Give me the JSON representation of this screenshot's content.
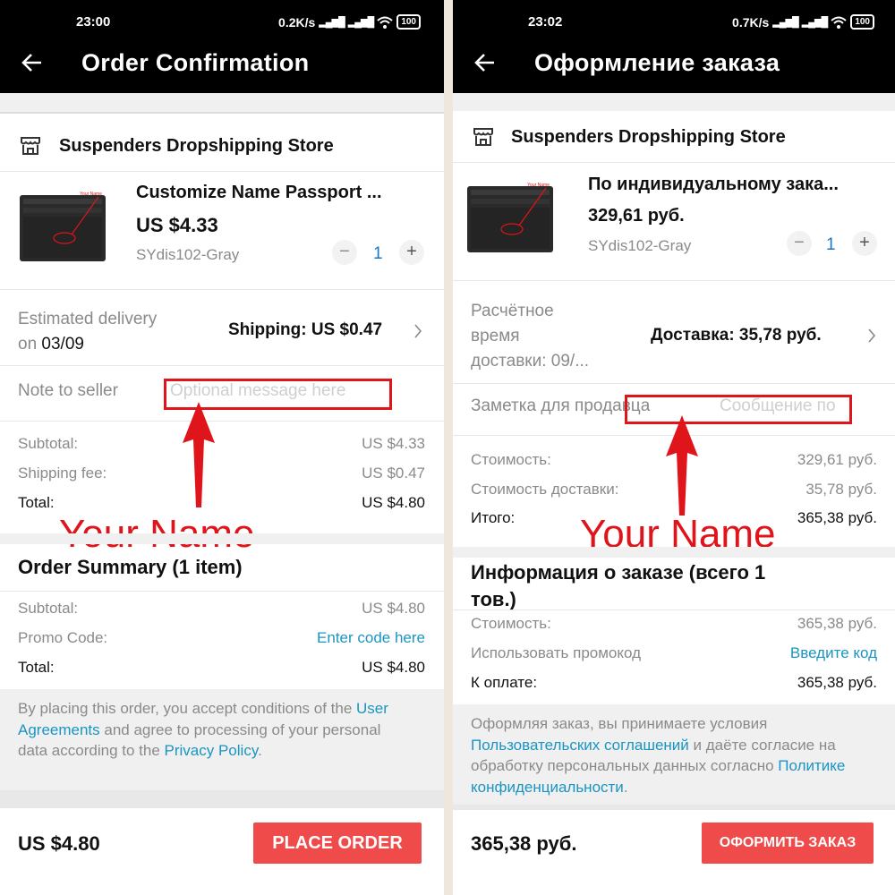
{
  "colors": {
    "accent_red": "#e0141b",
    "button_red": "#f04b4b",
    "link_blue": "#1a95c2",
    "qty_blue": "#1a78c2"
  },
  "left": {
    "status": {
      "time": "23:00",
      "speed": "0.2K/s",
      "battery": "100"
    },
    "header": {
      "title": "Order Confirmation"
    },
    "store_name": "Suspenders Dropshipping Store",
    "product": {
      "name": "Customize Name Passport ...",
      "price": "US $4.33",
      "sku": "SYdis102-Gray",
      "quantity": "1",
      "minus": "−",
      "plus": "+",
      "image_label": "Your Name"
    },
    "delivery": {
      "line1": "Estimated delivery",
      "line2_prefix": "on ",
      "date": "03/09",
      "shipping": "Shipping: US $0.47"
    },
    "note": {
      "label": "Note to seller",
      "placeholder": "Optional message here"
    },
    "costs": {
      "subtotal_label": "Subtotal:",
      "subtotal_value": "US $4.33",
      "shipping_label": "Shipping fee:",
      "shipping_value": "US $0.47",
      "total_label": "Total:",
      "total_value": "US $4.80"
    },
    "annotation": "Your Name",
    "summary": {
      "title": "Order Summary (1 item)",
      "subtotal_label": "Subtotal:",
      "subtotal_value": "US $4.80",
      "promo_label": "Promo Code:",
      "promo_value": "Enter code here",
      "total_label": "Total:",
      "total_value": "US $4.80"
    },
    "terms": {
      "p1": "By placing this order, you accept conditions of the ",
      "link1": "User Agreements",
      "p2": " and agree to processing of your personal data according to the ",
      "link2": "Privacy Policy",
      "p3": "."
    },
    "footer": {
      "total": "US $4.80",
      "button": "PLACE ORDER"
    }
  },
  "right": {
    "status": {
      "time": "23:02",
      "speed": "0.7K/s",
      "battery": "100"
    },
    "header": {
      "title": "Оформление заказа"
    },
    "store_name": "Suspenders Dropshipping Store",
    "product": {
      "name": "По индивидуальному зака...",
      "price": "329,61 руб.",
      "sku": "SYdis102-Gray",
      "quantity": "1",
      "minus": "−",
      "plus": "+",
      "image_label": "Your Name"
    },
    "delivery": {
      "line1": "Расчётное",
      "line2": "время",
      "line3": "доставки: 09/...",
      "shipping": "Доставка: 35,78 руб."
    },
    "note": {
      "label": "Заметка для продавца",
      "placeholder": "Сообщение по"
    },
    "costs": {
      "subtotal_label": "Стоимость:",
      "subtotal_value": "329,61 руб.",
      "shipping_label": "Стоимость доставки:",
      "shipping_value": "35,78 руб.",
      "total_label": "Итого:",
      "total_value": "365,38 руб."
    },
    "annotation": "Your Name",
    "summary": {
      "title_line1": "Информация о заказе (всего 1",
      "title_line2": "тов.)",
      "subtotal_label": "Стоимость:",
      "subtotal_value": "365,38 руб.",
      "promo_label": "Использовать промокод",
      "promo_value": "Введите код",
      "total_label": "К оплате:",
      "total_value": "365,38 руб."
    },
    "terms": {
      "p1": "Оформляя заказ, вы принимаете условия ",
      "link1": "Пользовательских соглашений",
      "p2": " и даёте согласие на обработку персональных данных согласно ",
      "link2": "Политике конфиденциальности",
      "p3": "."
    },
    "footer": {
      "total": "365,38 руб.",
      "button": "ОФОРМИТЬ ЗАКАЗ"
    }
  }
}
